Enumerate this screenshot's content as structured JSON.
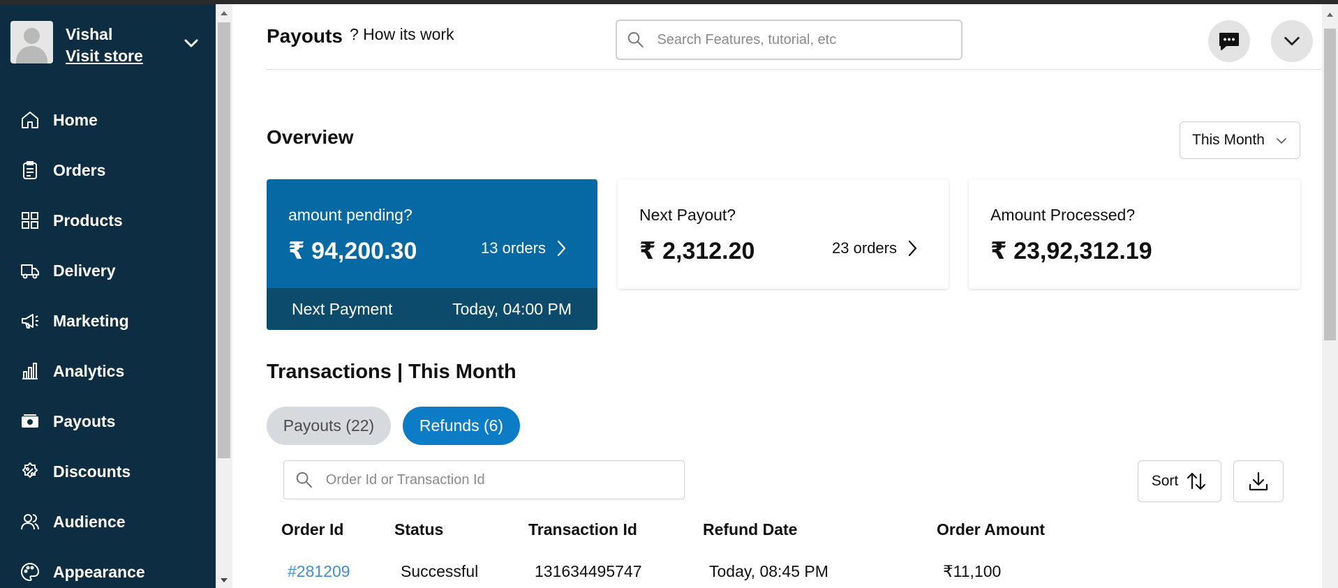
{
  "sidebar": {
    "profile": {
      "name": "Vishal",
      "visit_store": "Visit store"
    },
    "items": [
      {
        "label": "Home",
        "icon": "home-icon"
      },
      {
        "label": "Orders",
        "icon": "orders-icon"
      },
      {
        "label": "Products",
        "icon": "products-icon"
      },
      {
        "label": "Delivery",
        "icon": "delivery-icon"
      },
      {
        "label": "Marketing",
        "icon": "marketing-icon"
      },
      {
        "label": "Analytics",
        "icon": "analytics-icon"
      },
      {
        "label": "Payouts",
        "icon": "payouts-icon"
      },
      {
        "label": "Discounts",
        "icon": "discounts-icon"
      },
      {
        "label": "Audience",
        "icon": "audience-icon"
      },
      {
        "label": "Appearance",
        "icon": "appearance-icon"
      }
    ]
  },
  "header": {
    "title": "Payouts",
    "help_link": "? How its work",
    "search_placeholder": "Search Features, tutorial, etc"
  },
  "overview": {
    "title": "Overview",
    "period": "This Month",
    "cards": {
      "pending": {
        "label": "amount pending?",
        "amount": "₹ 94,200.30",
        "orders": "13 orders",
        "footer_label": "Next Payment",
        "footer_value": "Today, 04:00 PM"
      },
      "next_payout": {
        "label": "Next Payout?",
        "amount": "₹ 2,312.20",
        "orders": "23 orders"
      },
      "processed": {
        "label": "Amount Processed?",
        "amount": "₹ 23,92,312.19"
      }
    }
  },
  "transactions": {
    "title": "Transactions | This Month",
    "tabs": {
      "payouts": "Payouts (22)",
      "refunds": "Refunds (6)"
    },
    "search_placeholder": "Order Id or Transaction Id",
    "sort_label": "Sort",
    "columns": [
      "Order Id",
      "Status",
      "Transaction Id",
      "Refund Date",
      "Order Amount"
    ],
    "rows": [
      [
        "#281209",
        "Successful",
        "131634495747",
        "Today, 08:45 PM",
        "₹11,100"
      ]
    ]
  },
  "colors": {
    "sidebar_bg": "#0d2e42",
    "pending_card": "#0769a4",
    "pending_footer": "#0c4b6c",
    "active_tab": "#0d7cc7",
    "link": "#3d8fd6"
  }
}
